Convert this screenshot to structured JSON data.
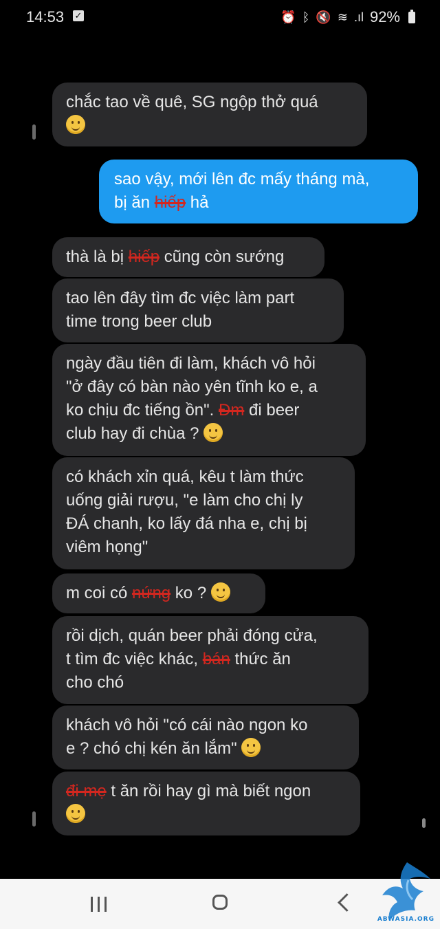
{
  "status_bar": {
    "time": "14:53",
    "battery": "92%",
    "icons": [
      "notification-check-icon",
      "alarm-icon",
      "bluetooth-icon",
      "mute-icon",
      "wifi-icon",
      "signal-icon",
      "battery-icon"
    ]
  },
  "messages": [
    {
      "side": "incoming",
      "parts": [
        {
          "t": "chắc tao về quê, SG ngộp thở quá"
        },
        {
          "br": true
        },
        {
          "emoji": "smile"
        }
      ]
    },
    {
      "side": "outgoing",
      "parts": [
        {
          "t": "sao vậy, mới lên đc mấy tháng mà,"
        },
        {
          "br": true
        },
        {
          "t": "bị ăn "
        },
        {
          "s": "hiếp"
        },
        {
          "t": " hả"
        }
      ]
    },
    {
      "side": "incoming",
      "parts": [
        {
          "t": "thà là bị "
        },
        {
          "s": "hiếp"
        },
        {
          "t": " cũng còn sướng"
        }
      ]
    },
    {
      "side": "incoming",
      "parts": [
        {
          "t": "tao lên đây tìm đc việc làm part"
        },
        {
          "br": true
        },
        {
          "t": "time trong beer club"
        }
      ]
    },
    {
      "side": "incoming",
      "parts": [
        {
          "t": "ngày đầu tiên đi làm, khách vô hỏi"
        },
        {
          "br": true
        },
        {
          "t": "\"ở đây có bàn nào yên tĩnh ko e, a"
        },
        {
          "br": true
        },
        {
          "t": "ko chịu đc tiếng ồn\". "
        },
        {
          "s": "Đm"
        },
        {
          "t": " đi beer"
        },
        {
          "br": true
        },
        {
          "t": "club hay đi chùa ? "
        },
        {
          "emoji": "smile"
        }
      ]
    },
    {
      "side": "incoming",
      "parts": [
        {
          "t": "có khách xỉn quá, kêu t làm thức"
        },
        {
          "br": true
        },
        {
          "t": "uống giải rượu, \"e làm cho chị ly"
        },
        {
          "br": true
        },
        {
          "t": "ĐÁ chanh, ko lấy đá nha e, chị bị"
        },
        {
          "br": true
        },
        {
          "t": "viêm họng\""
        }
      ]
    },
    {
      "side": "incoming",
      "parts": [
        {
          "t": "m coi có "
        },
        {
          "s": "nứng"
        },
        {
          "t": " ko ? "
        },
        {
          "emoji": "smile"
        }
      ]
    },
    {
      "side": "incoming",
      "parts": [
        {
          "t": "rồi dịch, quán beer phải đóng cửa,"
        },
        {
          "br": true
        },
        {
          "t": "t tìm đc việc khác, "
        },
        {
          "s": "bán"
        },
        {
          "t": " thức ăn"
        },
        {
          "br": true
        },
        {
          "t": "cho chó"
        }
      ]
    },
    {
      "side": "incoming",
      "parts": [
        {
          "t": "khách vô hỏi \"có cái nào ngon ko"
        },
        {
          "br": true
        },
        {
          "t": "e ? chó chị kén ăn lắm\" "
        },
        {
          "emoji": "smile"
        }
      ]
    },
    {
      "side": "incoming",
      "parts": [
        {
          "s": "đi mẹ"
        },
        {
          "t": " t ăn rồi hay gì mà biết ngon"
        },
        {
          "br": true
        },
        {
          "emoji": "smile"
        }
      ]
    }
  ],
  "nav": {
    "recents": "recent-apps-icon",
    "home": "home-icon",
    "back": "back-icon"
  },
  "watermark": {
    "text": "ABWASIA.ORG",
    "colors": {
      "primary": "#1a7fd0"
    }
  },
  "colors": {
    "incoming_bubble": "#2a2a2c",
    "outgoing_bubble": "#1e9bf0",
    "strike": "#d3271f",
    "background": "#000000"
  }
}
